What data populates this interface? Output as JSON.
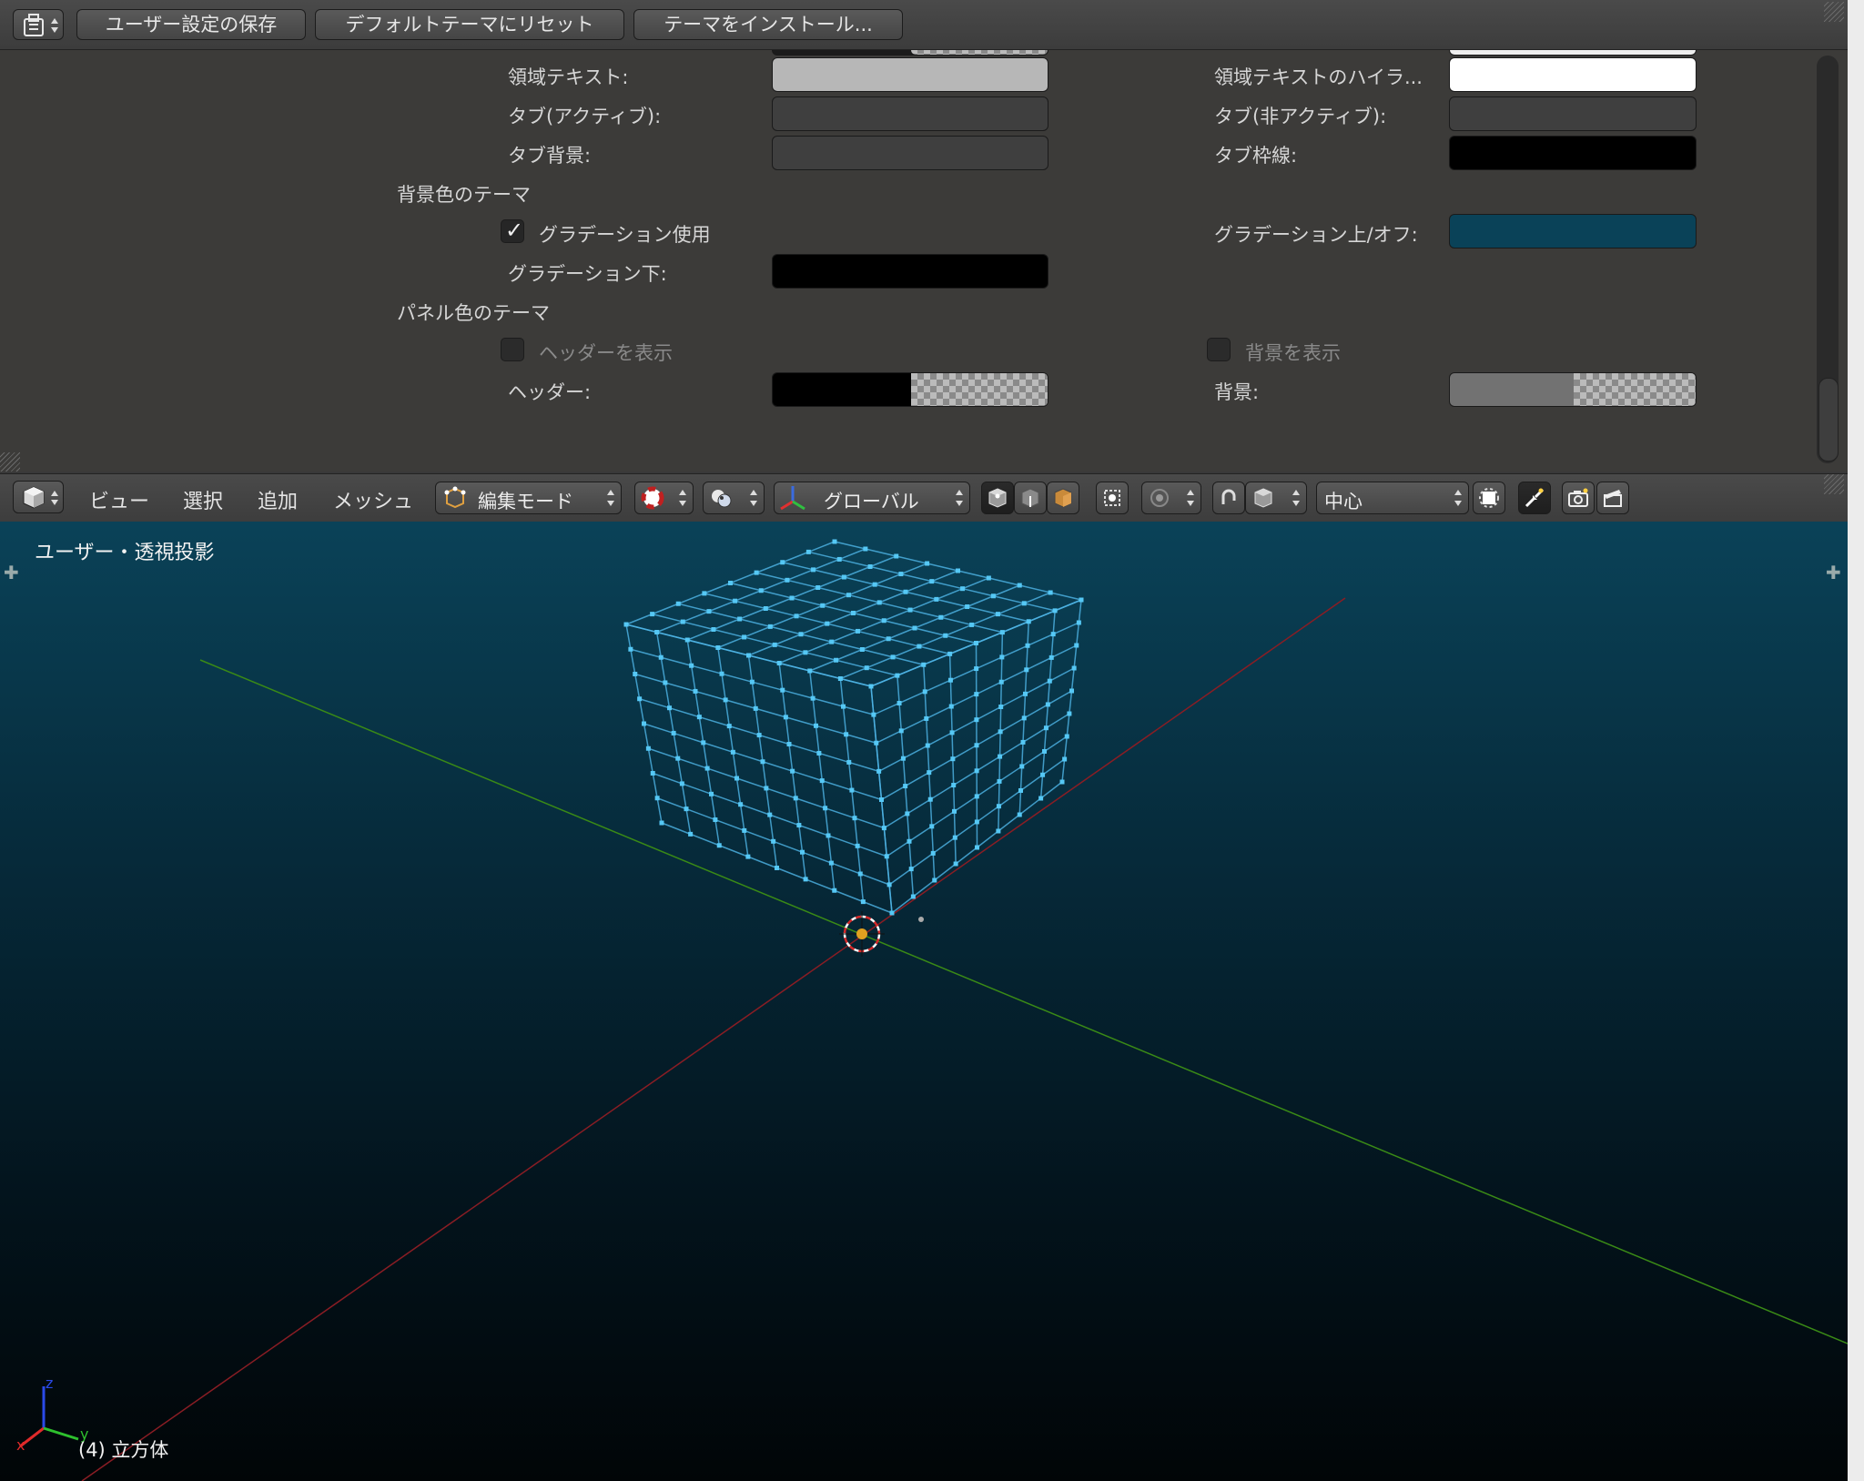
{
  "top_header": {
    "editor_type_icon": "user-preferences-icon",
    "save_button": "ユーザー設定の保存",
    "reset_button": "デフォルトテーマにリセット",
    "install_button": "テーマをインストール..."
  },
  "theme_settings": {
    "region_text_label": "領域テキスト:",
    "region_text_color": "#b7b7b7",
    "region_text_highlight_label": "領域テキストのハイラ...",
    "region_text_highlight_color": "#ffffff",
    "tab_active_label": "タブ(アクティブ):",
    "tab_active_color": "#3f3f3f",
    "tab_inactive_label": "タブ(非アクティブ):",
    "tab_inactive_color": "#3f3f3f",
    "tab_back_label": "タブ背景:",
    "tab_back_color": "#3f3f3f",
    "tab_outline_label": "タブ枠線:",
    "tab_outline_color": "#000000",
    "background_section": "背景色のテーマ",
    "use_gradient_label": "グラデーション使用",
    "use_gradient_checked": true,
    "gradient_high_label": "グラデーション上/オフ:",
    "gradient_high_color": "#0a4258",
    "gradient_low_label": "グラデーション下:",
    "gradient_low_color": "#000000",
    "panel_section": "パネル色のテーマ",
    "show_header_label": "ヘッダーを表示",
    "show_header_checked": false,
    "show_back_label": "背景を表示",
    "show_back_checked": false,
    "header_label": "ヘッダー:",
    "header_color": "#000000",
    "back_label": "背景:",
    "back_color": "#727272"
  },
  "view_header": {
    "editor_type_icon": "3d-view-icon",
    "menus": [
      "ビュー",
      "選択",
      "追加",
      "メッシュ"
    ],
    "mode_label": "編集モード",
    "mode_icon": "edit-mode-icon",
    "shading_icon": "viewport-shading-icon",
    "pivot_icon": "pivot-point-icon",
    "orientation_label": "グローバル",
    "orientation_icon": "transform-manipulator-icon",
    "select_mode_icons": [
      "vertex-select-icon",
      "edge-select-icon",
      "face-select-icon"
    ],
    "occlude_icon": "occlude-geometry-icon",
    "proportional_icon": "proportional-edit-icon",
    "snap_icon": "snap-magnet-icon",
    "snap_element_icon": "snap-element-icon",
    "snap_target_label": "中心",
    "render_icons": [
      "opengl-render-icon",
      "opengl-animation-icon"
    ]
  },
  "viewport": {
    "view_label": "ユーザー・透視投影",
    "object_label": "(4) 立方体",
    "axis_x_label": "x",
    "axis_y_label": "y",
    "axis_z_label": "z",
    "mesh_color": "#4fb6e8",
    "grid_x_color": "#8a1d24",
    "grid_y_color": "#3a8a16"
  }
}
